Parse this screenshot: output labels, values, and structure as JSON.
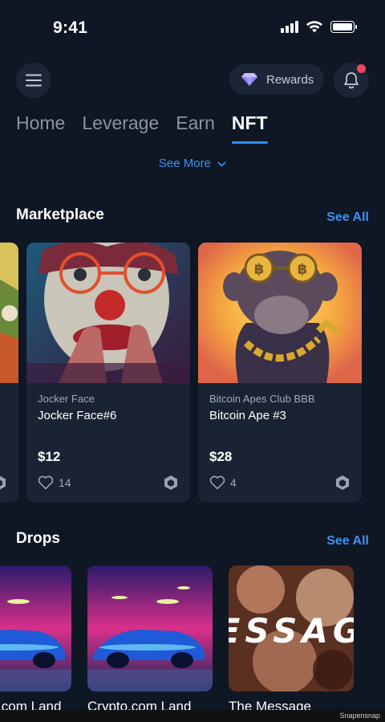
{
  "status": {
    "time": "9:41"
  },
  "header": {
    "rewards_label": "Rewards",
    "has_notification": true
  },
  "tabs": [
    {
      "label": "Home",
      "active": false
    },
    {
      "label": "Leverage",
      "active": false
    },
    {
      "label": "Earn",
      "active": false
    },
    {
      "label": "NFT",
      "active": true
    }
  ],
  "see_more_label": "See More",
  "marketplace": {
    "title": "Marketplace",
    "see_all_label": "See All",
    "cards": [
      {
        "collection": "Jocker Face",
        "name": "Jocker Face#6",
        "price": "$12",
        "likes": "14",
        "chain_icon": "chain-hexagon-icon"
      },
      {
        "collection": "Bitcoin Apes Club BBB",
        "name": "Bitcoin Ape #3",
        "price": "$28",
        "likes": "4",
        "chain_icon": "chain-hexagon-icon"
      }
    ]
  },
  "drops": {
    "title": "Drops",
    "see_all_label": "See All",
    "items": [
      {
        "label": "Crypto.com Land"
      },
      {
        "label": "Crypto.com Land"
      },
      {
        "label": "The Message",
        "art_text": "ESSAG"
      }
    ]
  },
  "watermark": "Snapensnap",
  "colors": {
    "background": "#0f1624",
    "accent": "#3a92f2",
    "card": "#1a2333",
    "notification": "#ef4760"
  }
}
